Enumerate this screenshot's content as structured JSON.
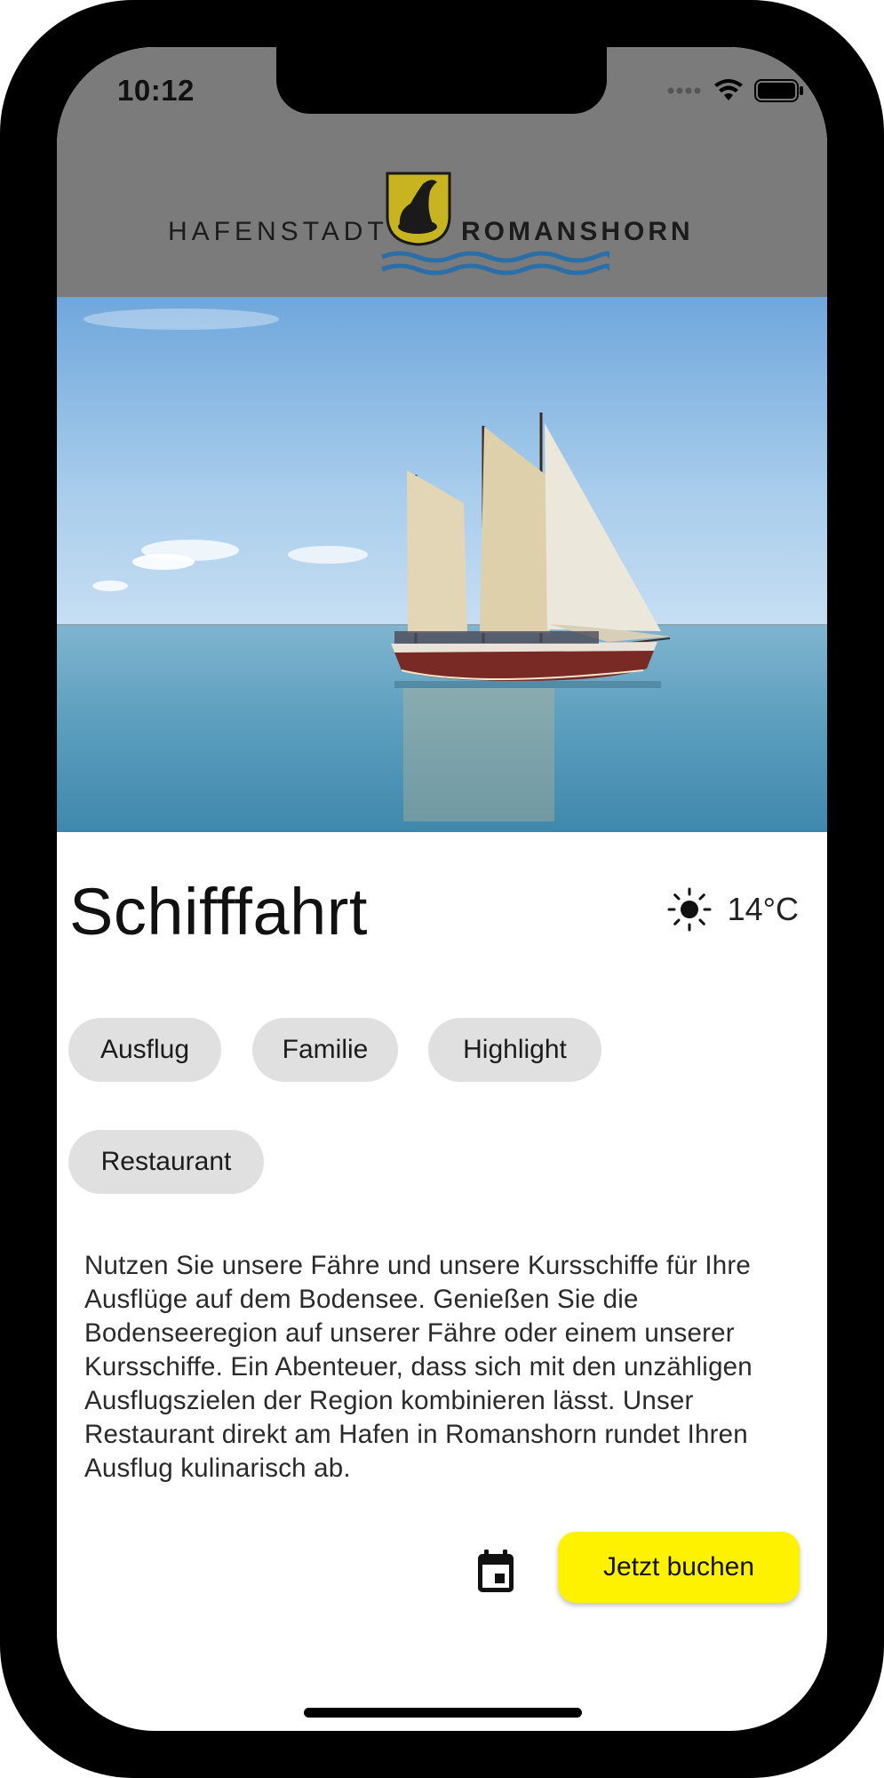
{
  "status_bar": {
    "time": "10:12",
    "icons": [
      "signal-dots-icon",
      "wifi-icon",
      "battery-icon"
    ]
  },
  "header": {
    "logo_left": "HAFENSTADT",
    "logo_right": "ROMANSHORN",
    "background": "#7b7b7b",
    "crest_color": "#c8b420"
  },
  "hero": {
    "image": "sailing-ship-on-lake-photo"
  },
  "detail": {
    "title": "Schifffahrt",
    "weather_icon": "sun-icon",
    "temperature": "14°C",
    "tags": [
      "Ausflug",
      "Familie",
      "Highlight",
      "Restaurant"
    ],
    "description": "Nutzen Sie unsere Fähre und unsere Kursschiffe für Ihre Ausflüge auf dem Bodensee. Genießen Sie die Bodenseeregion auf unserer Fähre oder einem unserer Kursschiffe. Ein Abenteuer, dass sich mit den unzähligen Ausflugszielen der Region kombinieren lässt. Unser Restaurant direkt am Hafen in Romanshorn rundet Ihren Ausflug kulinarisch ab."
  },
  "actions": {
    "calendar_icon": "calendar-icon",
    "book_label": "Jetzt buchen",
    "book_color": "#fff200"
  }
}
